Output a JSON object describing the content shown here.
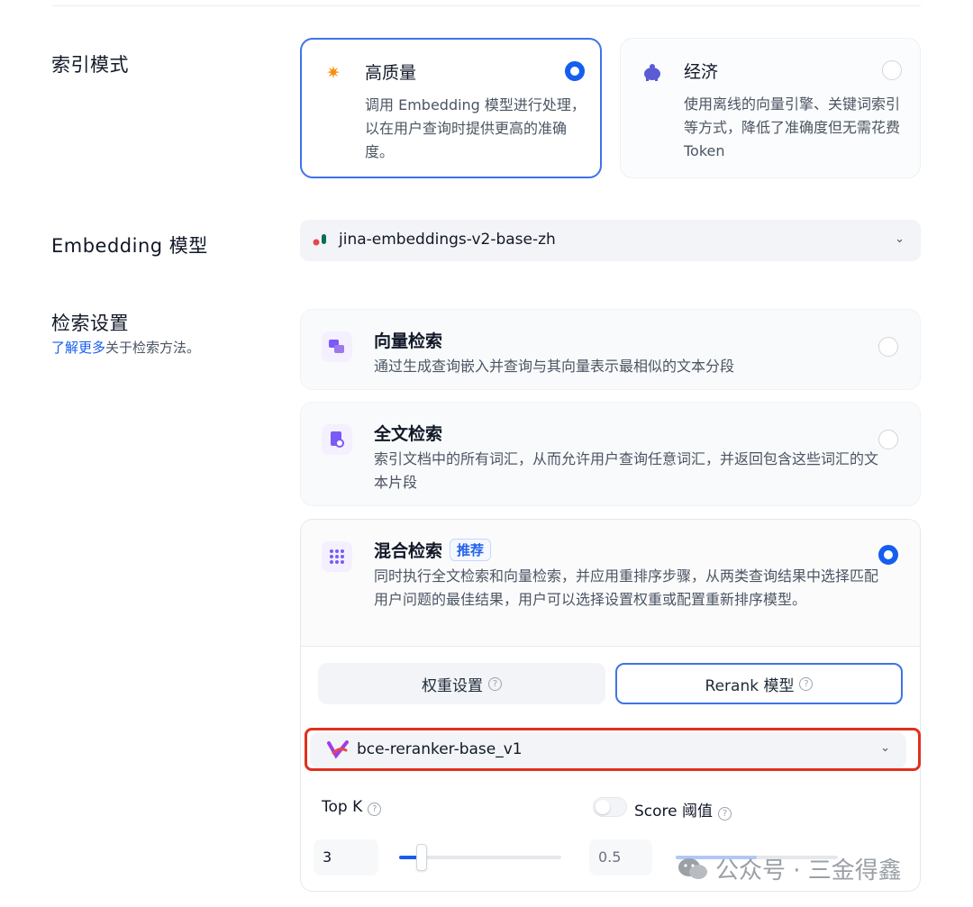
{
  "index_mode": {
    "label": "索引模式",
    "options": [
      {
        "title": "高质量",
        "desc": "调用 Embedding 模型进行处理，以在用户查询时提供更高的准确度。",
        "selected": true
      },
      {
        "title": "经济",
        "desc": "使用离线的向量引擎、关键词索引等方式，降低了准确度但无需花费 Token",
        "selected": false
      }
    ]
  },
  "embedding": {
    "label": "Embedding 模型",
    "value": "jina-embeddings-v2-base-zh"
  },
  "retrieval": {
    "label": "检索设置",
    "learn_more": "了解更多",
    "learn_more_suffix": "关于检索方法。",
    "options": [
      {
        "title": "向量检索",
        "desc": "通过生成查询嵌入并查询与其向量表示最相似的文本分段",
        "selected": false
      },
      {
        "title": "全文检索",
        "desc": "索引文档中的所有词汇，从而允许用户查询任意词汇，并返回包含这些词汇的文本片段",
        "selected": false
      },
      {
        "title": "混合检索",
        "badge": "推荐",
        "desc": "同时执行全文检索和向量检索，并应用重排序步骤，从两类查询结果中选择匹配用户问题的最佳结果，用户可以选择设置权重或配置重新排序模型。",
        "selected": true
      }
    ],
    "tabs": [
      {
        "label": "权重设置",
        "active": false
      },
      {
        "label": "Rerank 模型",
        "active": true
      }
    ],
    "rerank_model": "bce-reranker-base_v1",
    "top_k": {
      "label": "Top K",
      "value": "3",
      "fraction": 0.14
    },
    "score_threshold": {
      "label": "Score 阈值",
      "enabled": false,
      "value": "0.5",
      "fraction": 0.5
    }
  },
  "watermark": "公众号 · 三金得鑫",
  "colors": {
    "accent": "#155eef",
    "highlight_outline": "#e0301e"
  }
}
